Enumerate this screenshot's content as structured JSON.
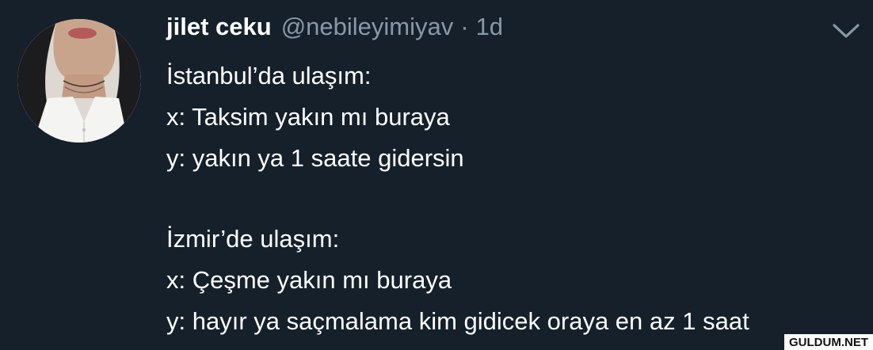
{
  "tweet": {
    "author_name": "jilet ceku",
    "handle": "@nebileyimiyav",
    "separator": "·",
    "time": "1d",
    "menu_icon": "chevron-down-icon",
    "lines": [
      "İstanbul’da ulaşım:",
      "x: Taksim yakın mı buraya",
      "y: yakın ya 1 saate gidersin",
      "",
      "İzmir’de ulaşım:",
      "x: Çeşme yakın mı buraya",
      "y: hayır ya saçmalama kim gidicek oraya en az 1 saat"
    ]
  },
  "watermark": "GULDUM.NET",
  "colors": {
    "background": "#15202b",
    "text": "#ffffff",
    "secondary_text": "#8899a6"
  }
}
